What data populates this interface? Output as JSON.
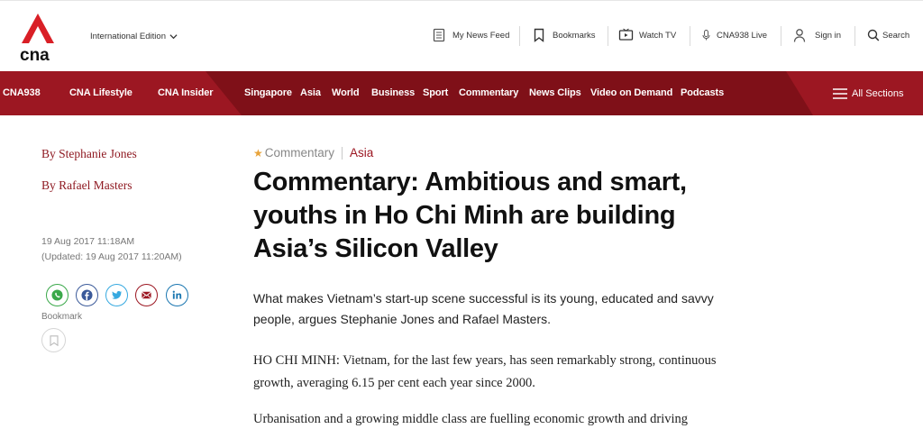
{
  "header": {
    "logo_text": "cna",
    "edition": "International Edition",
    "utilities": [
      {
        "icon": "newsfeed-icon",
        "label": "My News Feed"
      },
      {
        "icon": "bookmark-icon",
        "label": "Bookmarks"
      },
      {
        "icon": "tv-icon",
        "label": "Watch TV"
      },
      {
        "icon": "microphone-icon",
        "label": "CNA938 Live"
      },
      {
        "icon": "user-icon",
        "label": "Sign in"
      },
      {
        "icon": "search-icon",
        "label": "Search"
      }
    ]
  },
  "nav": {
    "brands": [
      "CNA938",
      "CNA Lifestyle",
      "CNA Insider"
    ],
    "items": [
      "Singapore",
      "Asia",
      "World",
      "Business",
      "Sport",
      "Commentary",
      "News Clips",
      "Video on Demand",
      "Podcasts"
    ],
    "all_sections": "All Sections",
    "colors": {
      "bar": "#7f1018",
      "panel": "#9c1722"
    }
  },
  "article": {
    "authors": [
      "By Stephanie Jones",
      "By Rafael Masters"
    ],
    "published": "19 Aug 2017 11:18AM",
    "updated": "(Updated: 19 Aug 2017 11:20AM)",
    "share": [
      {
        "icon": "whatsapp-icon",
        "color": "#3aa84a"
      },
      {
        "icon": "facebook-icon",
        "color": "#3b5a9a"
      },
      {
        "icon": "twitter-icon",
        "color": "#36a9e0"
      },
      {
        "icon": "email-icon",
        "color": "#9c1722"
      },
      {
        "icon": "linkedin-icon",
        "color": "#1a76b0"
      }
    ],
    "bookmark_label": "Bookmark",
    "category": "Commentary",
    "topic": "Asia",
    "headline": "Commentary: Ambitious and smart, youths in Ho Chi Minh are building Asia’s Silicon Valley",
    "summary": "What makes Vietnam’s start-up scene successful is its young, educated and savvy people, argues Stephanie Jones and Rafael Masters.",
    "paragraphs": [
      "HO CHI MINH: Vietnam, for the last few years, has seen remarkably strong, continuous growth, averaging 6.15 per cent each year since 2000.",
      "Urbanisation and a growing middle class are fuelling economic growth and driving"
    ]
  }
}
